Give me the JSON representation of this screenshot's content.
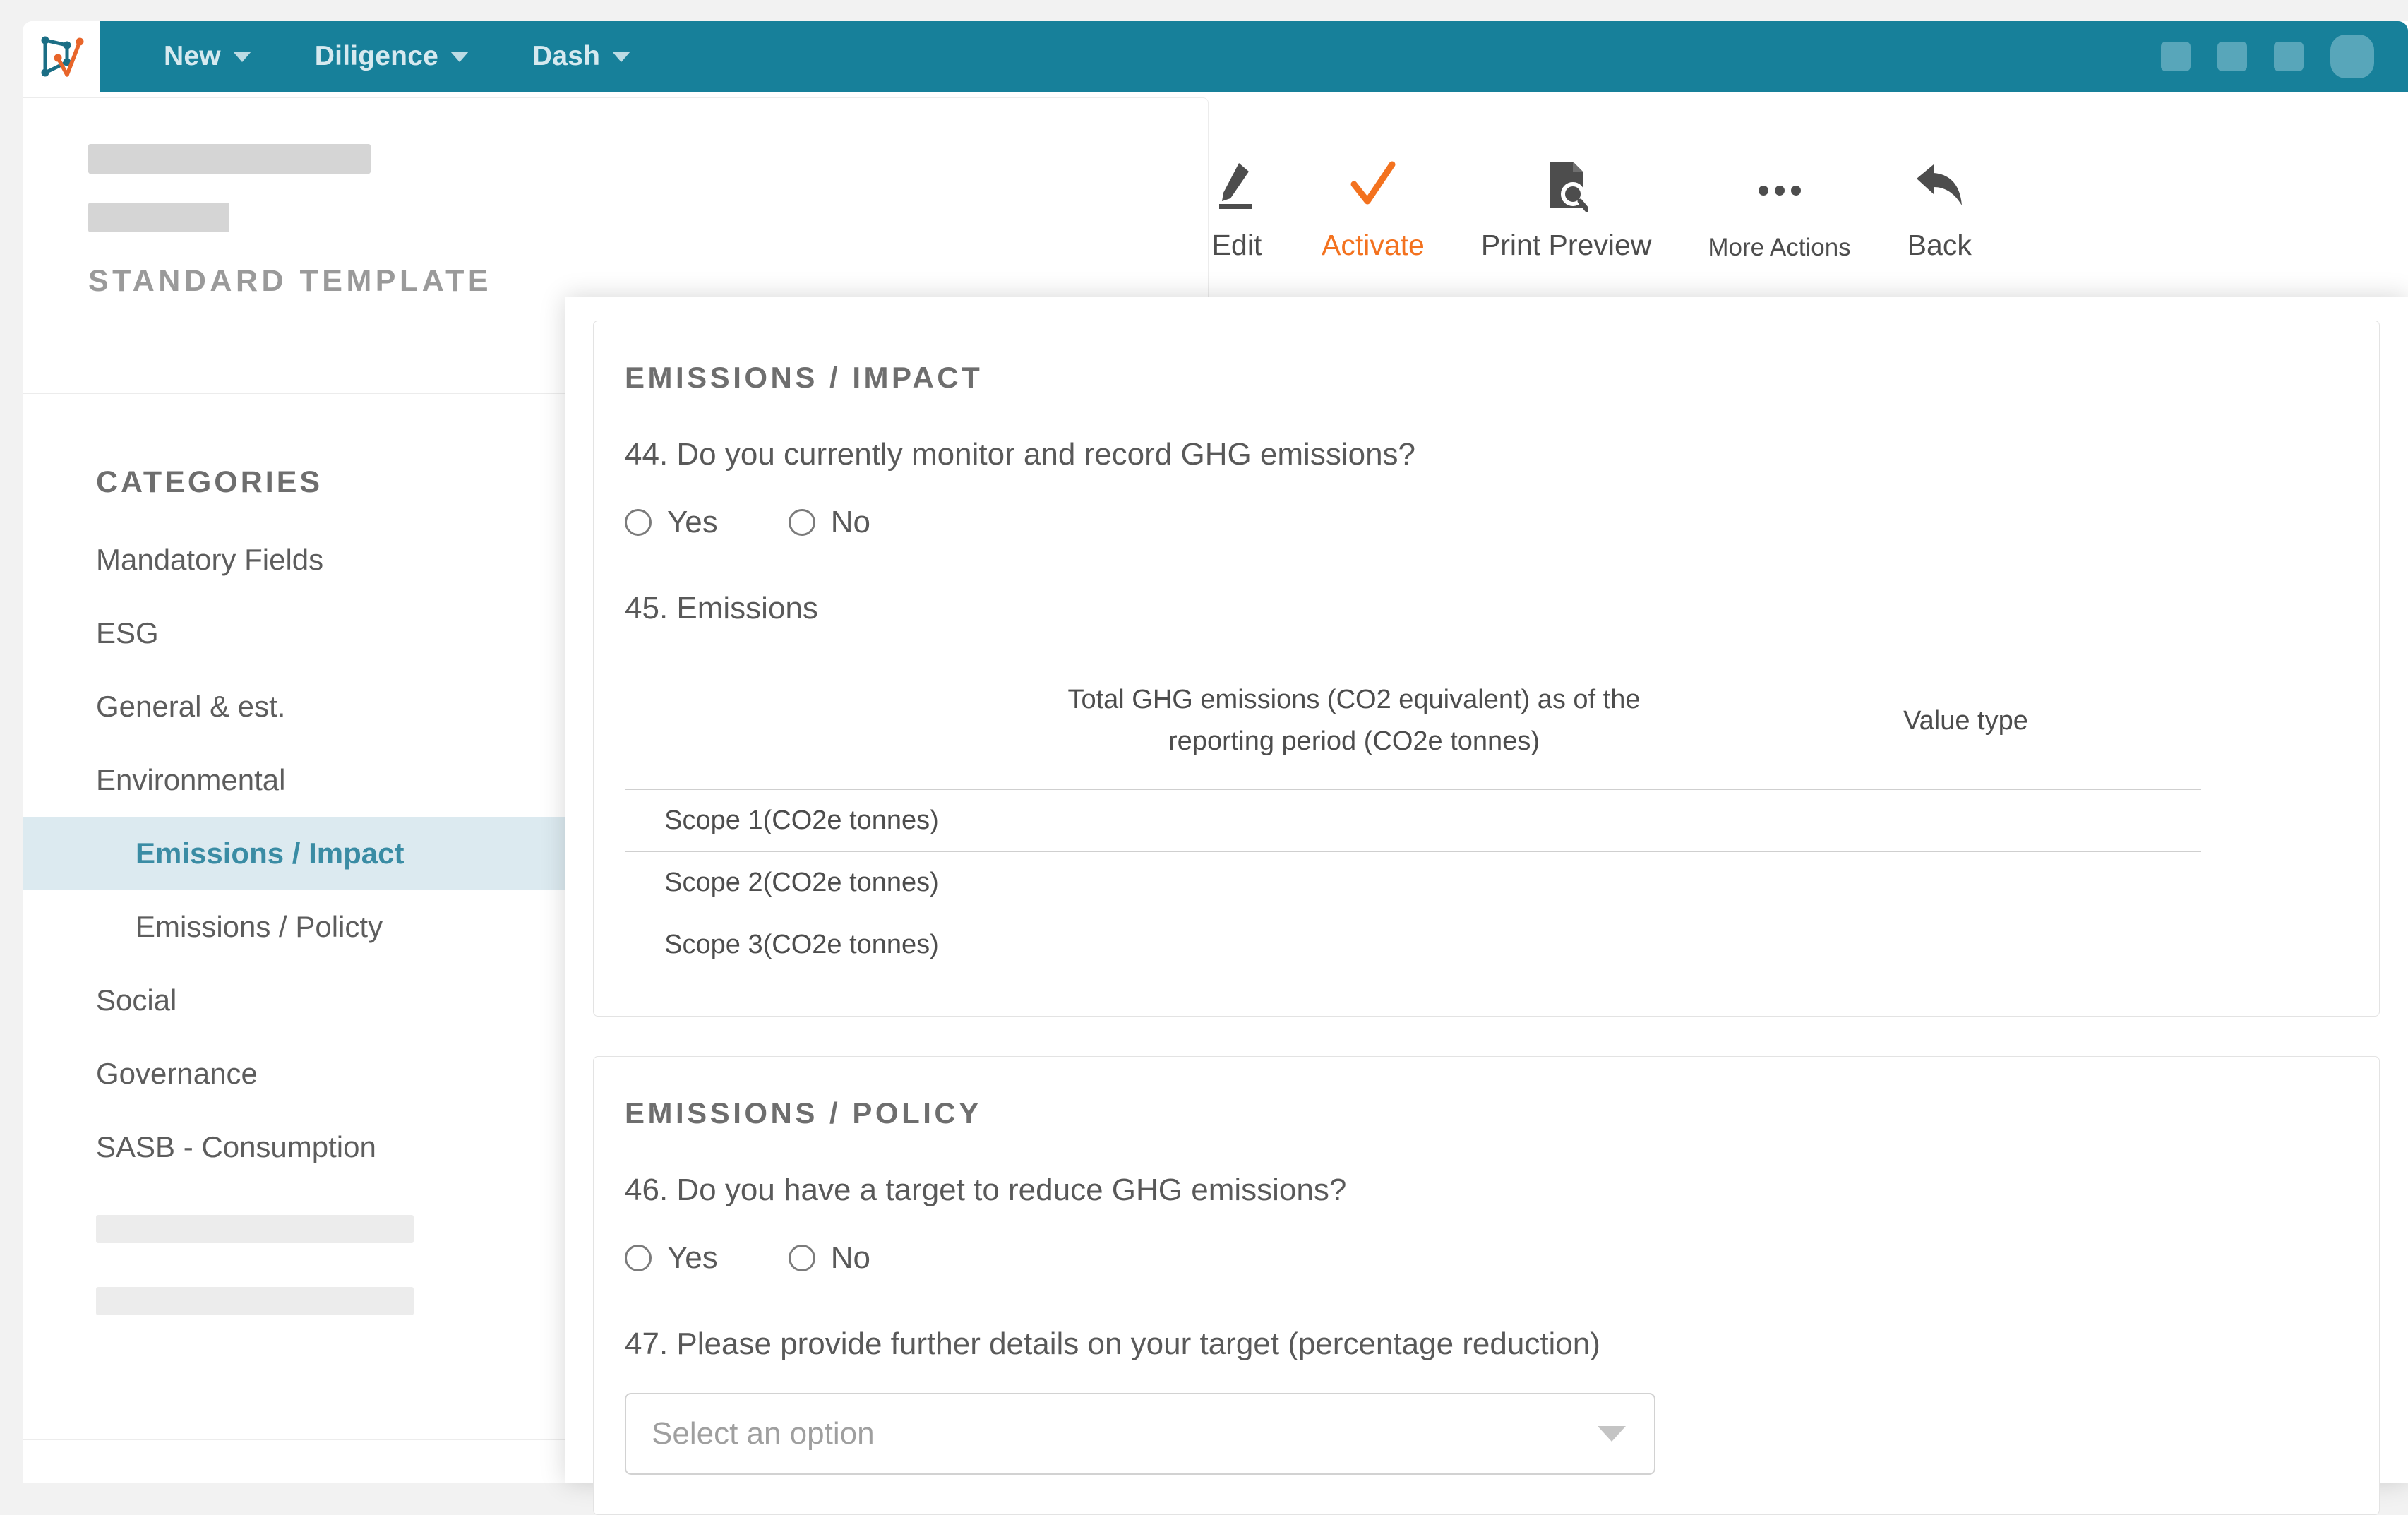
{
  "brand": {
    "teal": "#17809a",
    "accent_orange": "#f3721f",
    "highlight_bg": "#dceaf0",
    "highlight_text": "#3a8ca4",
    "logo_name": "diligence-logo"
  },
  "navbar": {
    "items": [
      {
        "label": "New",
        "icon": "chevron-down-icon"
      },
      {
        "label": "Diligence",
        "icon": "chevron-down-icon"
      },
      {
        "label": "Dash",
        "icon": "chevron-down-icon"
      }
    ],
    "right_icons": [
      "app-square-icon-1",
      "app-square-icon-2",
      "app-square-icon-3",
      "user-avatar"
    ]
  },
  "header": {
    "redacted_title": "",
    "redacted_subtitle": "",
    "template_label": "STANDARD TEMPLATE"
  },
  "toolbar": {
    "actions": [
      {
        "label": "Edit",
        "icon": "pencil-icon",
        "accent": false
      },
      {
        "label": "Activate",
        "icon": "check-icon",
        "accent": true
      },
      {
        "label": "Print Preview",
        "icon": "document-search-icon",
        "accent": false
      },
      {
        "label": "More Actions",
        "icon": "ellipsis-icon",
        "accent": false
      },
      {
        "label": "Back",
        "icon": "back-arrow-icon",
        "accent": false
      }
    ]
  },
  "sidebar": {
    "title": "CATEGORIES",
    "items": [
      {
        "label": "Mandatory Fields",
        "sub": false,
        "active": false
      },
      {
        "label": "ESG",
        "sub": false,
        "active": false
      },
      {
        "label": "General & est.",
        "sub": false,
        "active": false
      },
      {
        "label": "Environmental",
        "sub": false,
        "active": false
      },
      {
        "label": "Emissions / Impact",
        "sub": true,
        "active": true
      },
      {
        "label": "Emissions / Policty",
        "sub": true,
        "active": false
      },
      {
        "label": "Social",
        "sub": false,
        "active": false
      },
      {
        "label": "Governance",
        "sub": false,
        "active": false
      },
      {
        "label": "SASB - Consumption",
        "sub": false,
        "active": false
      }
    ]
  },
  "main": {
    "sections": [
      {
        "title": "EMISSIONS / IMPACT",
        "questions": [
          {
            "type": "radio",
            "text": "44. Do you currently monitor and record GHG emissions?",
            "options": [
              "Yes",
              "No"
            ]
          },
          {
            "type": "table",
            "text": "45. Emissions",
            "table": {
              "headers": [
                "",
                "Total GHG emissions (CO2 equivalent) as of the reporting period (CO2e tonnes)",
                "Value type"
              ],
              "rows": [
                {
                  "label": "Scope 1(CO2e tonnes)",
                  "total": "",
                  "value_type": ""
                },
                {
                  "label": "Scope 2(CO2e tonnes)",
                  "total": "",
                  "value_type": ""
                },
                {
                  "label": "Scope 3(CO2e tonnes)",
                  "total": "",
                  "value_type": ""
                }
              ]
            }
          }
        ]
      },
      {
        "title": "EMISSIONS / POLICY",
        "questions": [
          {
            "type": "radio",
            "text": "46. Do you have a target to reduce GHG emissions?",
            "options": [
              "Yes",
              "No"
            ]
          },
          {
            "type": "select",
            "text": "47. Please provide further details on your target (percentage reduction)",
            "select": {
              "placeholder": "Select an option",
              "value": "",
              "icon": "caret-down-icon"
            }
          }
        ]
      }
    ]
  }
}
